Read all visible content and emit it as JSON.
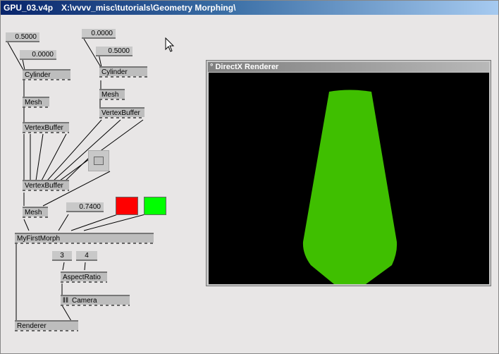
{
  "window": {
    "file": "GPU_03.v4p",
    "path": "X:\\vvvv_misc\\tutorials\\Geometry Morphing\\"
  },
  "iobox": {
    "v1": "0.5000",
    "v2": "0.0000",
    "v3": "0.0000",
    "v4": "0.5000",
    "v5": "0.7400",
    "v6": "3",
    "v7": "4"
  },
  "nodes": {
    "cylinder_left": "Cylinder",
    "cylinder_right": "Cylinder",
    "mesh_left": "Mesh",
    "mesh_right": "Mesh",
    "vertexbuffer_left": "VertexBuffer",
    "vertexbuffer_right": "VertexBuffer",
    "vertexbuffer_join": "VertexBuffer",
    "mesh_join": "Mesh",
    "morph": "MyFirstMorph",
    "aspect": "AspectRatio",
    "camera": "Camera",
    "renderer": "Renderer"
  },
  "colors": {
    "red": "#ff0000",
    "green": "#00ff00",
    "shape": "#3fbf00"
  },
  "renderer_window": {
    "title": "DirectX Renderer"
  }
}
